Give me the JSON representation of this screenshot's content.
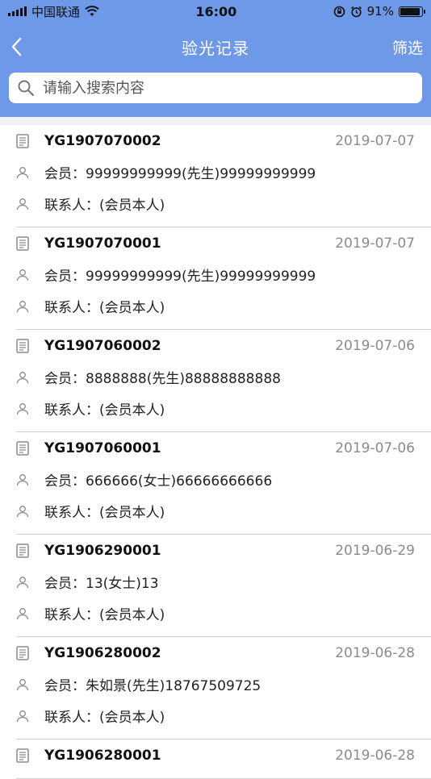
{
  "status": {
    "carrier": "中国联通",
    "time": "16:00",
    "battery": "91%",
    "battery_level": 0.91
  },
  "nav": {
    "title": "验光记录",
    "filter_label": "筛选"
  },
  "search": {
    "placeholder": "请输入搜索内容"
  },
  "records": [
    {
      "code": "YG1907070002",
      "date": "2019-07-07",
      "member": "会员：99999999999(先生)99999999999",
      "contact": "联系人：(会员本人)"
    },
    {
      "code": "YG1907070001",
      "date": "2019-07-07",
      "member": "会员：99999999999(先生)99999999999",
      "contact": "联系人：(会员本人)"
    },
    {
      "code": "YG1907060002",
      "date": "2019-07-06",
      "member": "会员：8888888(先生)88888888888",
      "contact": "联系人：(会员本人)"
    },
    {
      "code": "YG1907060001",
      "date": "2019-07-06",
      "member": "会员：666666(女士)66666666666",
      "contact": "联系人：(会员本人)"
    },
    {
      "code": "YG1906290001",
      "date": "2019-06-29",
      "member": "会员：13(女士)13",
      "contact": "联系人：(会员本人)"
    },
    {
      "code": "YG1906280002",
      "date": "2019-06-28",
      "member": "会员：朱如景(先生)18767509725",
      "contact": "联系人：(会员本人)"
    },
    {
      "code": "YG1906280001",
      "date": "2019-06-28",
      "member": "",
      "contact": ""
    }
  ]
}
